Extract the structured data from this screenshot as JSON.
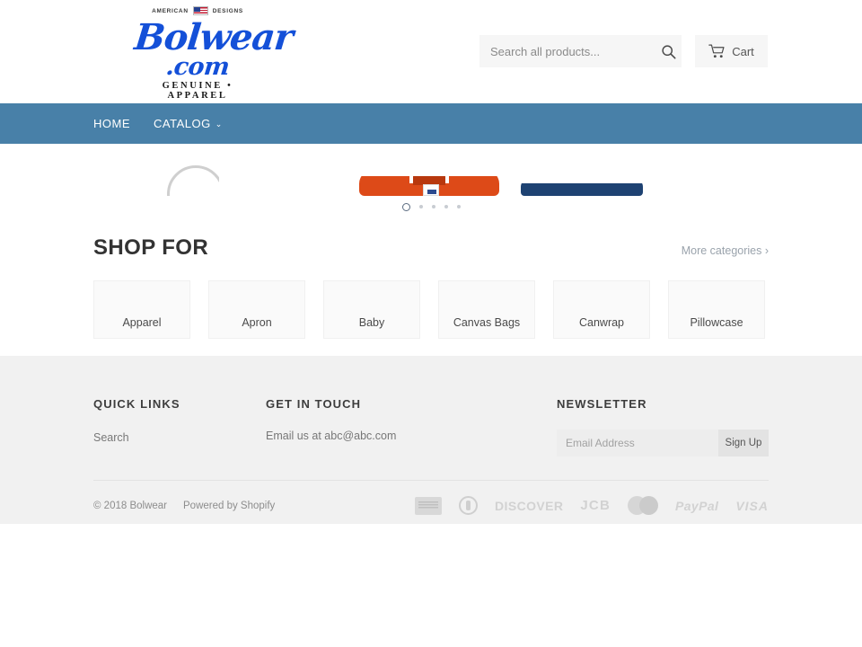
{
  "header": {
    "logo": {
      "top_left": "AMERICAN",
      "flag_icon": "us-flag-icon",
      "top_right": "DESIGNS",
      "script": "Bolwear",
      "dotcom": ".com",
      "tagline": "GENUINE • APPAREL",
      "color": "#1450d8"
    },
    "search": {
      "placeholder": "Search all products...",
      "value": "",
      "icon": "search-icon"
    },
    "cart": {
      "label": "Cart",
      "icon": "cart-icon"
    }
  },
  "nav": {
    "background": "#4880a8",
    "items": [
      {
        "label": "HOME",
        "has_chevron": false
      },
      {
        "label": "CATALOG",
        "has_chevron": true,
        "chevron": "⌄"
      }
    ]
  },
  "slideshow": {
    "dots": [
      {
        "active": true
      },
      {
        "active": false
      },
      {
        "active": false
      },
      {
        "active": false
      },
      {
        "active": false
      }
    ],
    "slide_colors": {
      "orange": "#dd4a18",
      "navy": "#1e4272"
    }
  },
  "shop": {
    "title": "SHOP FOR",
    "more_link": "More categories ›",
    "categories": [
      {
        "label": "Apparel"
      },
      {
        "label": "Apron"
      },
      {
        "label": "Baby"
      },
      {
        "label": "Canvas Bags"
      },
      {
        "label": "Canwrap"
      },
      {
        "label": "Pillowcase"
      }
    ]
  },
  "footer": {
    "quick_links": {
      "title": "QUICK LINKS",
      "items": [
        {
          "label": "Search"
        }
      ]
    },
    "get_in_touch": {
      "title": "GET IN TOUCH",
      "text": "Email us at abc@abc.com"
    },
    "newsletter": {
      "title": "NEWSLETTER",
      "placeholder": "Email Address",
      "value": "",
      "button": "Sign Up"
    },
    "copyright": "© 2018 Bolwear",
    "powered_by": "Powered by Shopify",
    "payment_icons": [
      {
        "name": "american-express-icon",
        "label": ""
      },
      {
        "name": "diners-club-icon",
        "label": ""
      },
      {
        "name": "discover-icon",
        "label": "DISCOVER"
      },
      {
        "name": "jcb-icon",
        "label": "JCB"
      },
      {
        "name": "mastercard-icon",
        "label": ""
      },
      {
        "name": "paypal-icon",
        "label": "PayPal"
      },
      {
        "name": "visa-icon",
        "label": "VISA"
      }
    ]
  }
}
